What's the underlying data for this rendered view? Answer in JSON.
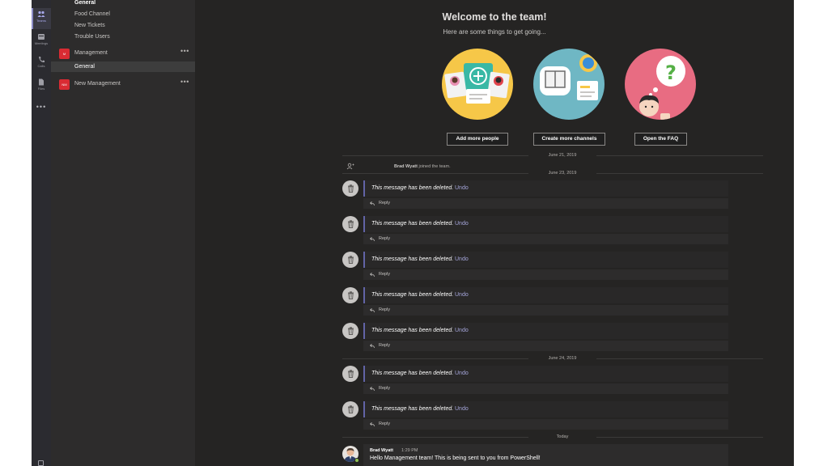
{
  "rail": {
    "items": [
      {
        "label": "",
        "icon": "activity-icon"
      },
      {
        "label": "Teams",
        "icon": "teams-icon",
        "active": true
      },
      {
        "label": "Meetings",
        "icon": "meetings-icon"
      },
      {
        "label": "Calls",
        "icon": "calls-icon"
      },
      {
        "label": "Files",
        "icon": "files-icon"
      }
    ],
    "more": "•••"
  },
  "panel": {
    "channels_top": [
      {
        "label": "General",
        "bold": true
      },
      {
        "label": "Food Channel"
      },
      {
        "label": "New Tickets"
      },
      {
        "label": "Trouble Users"
      }
    ],
    "team1": {
      "name": "Management",
      "initials": "M",
      "more": "•••"
    },
    "team1_channels": [
      {
        "label": "General",
        "selected": true
      }
    ],
    "team2": {
      "name": "New Management",
      "initials": "NM",
      "more": "•••"
    }
  },
  "welcome": {
    "title": "Welcome to the team!",
    "subtitle": "Here are some things to get going...",
    "buttons": [
      "Add more people",
      "Create more channels",
      "Open the FAQ"
    ]
  },
  "feed": {
    "dates": [
      "June 21, 2019",
      "June 23, 2019",
      "June 24, 2019",
      "Today"
    ],
    "join": {
      "name": "Brad Wyatt",
      "text": "joined the team."
    },
    "deleted_text": "This message has been deleted.",
    "undo_label": "Undo",
    "reply_label": "Reply",
    "last_message": {
      "author": "Brad Wyatt",
      "time": "1:29 PM",
      "text": "Hello Management team! This is being sent to you from PowerShell!"
    }
  },
  "colors": {
    "accent": "#6264a7",
    "team_red": "#d92b33",
    "presence": "#92c353"
  }
}
